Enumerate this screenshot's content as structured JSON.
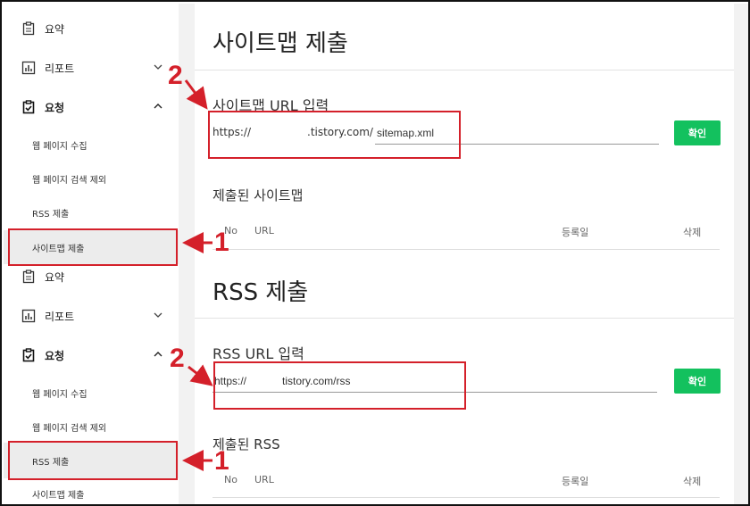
{
  "sidebar_top": {
    "summary": "요약",
    "report": "리포트",
    "request": "요청",
    "sub_items": [
      "웹 페이지 수집",
      "웹 페이지 검색 제외",
      "RSS 제출",
      "사이트맵 제출"
    ]
  },
  "sidebar_bottom": {
    "summary": "요약",
    "report": "리포트",
    "request": "요청",
    "sub_items": [
      "웹 페이지 수집",
      "웹 페이지 검색 제외",
      "RSS 제출",
      "사이트맵 제출"
    ]
  },
  "sitemap": {
    "title": "사이트맵 제출",
    "input_label": "사이트맵 URL 입력",
    "url_scheme": "https://",
    "url_domain": ".tistory.com/",
    "url_value": "sitemap.xml",
    "confirm": "확인",
    "submitted_title": "제출된 사이트맵",
    "columns": {
      "no": "No",
      "url": "URL",
      "date": "등록일",
      "delete": "삭제"
    }
  },
  "rss": {
    "title": "RSS 제출",
    "input_label": "RSS URL 입력",
    "url_value": "https://            tistory.com/rss",
    "confirm": "확인",
    "submitted_title": "제출된 RSS",
    "columns": {
      "no": "No",
      "url": "URL",
      "date": "등록일",
      "delete": "삭제"
    }
  },
  "annotations": {
    "step1": "1",
    "step2": "2"
  },
  "colors": {
    "annotation_red": "#d4202a",
    "confirm_green": "#13c15e"
  }
}
